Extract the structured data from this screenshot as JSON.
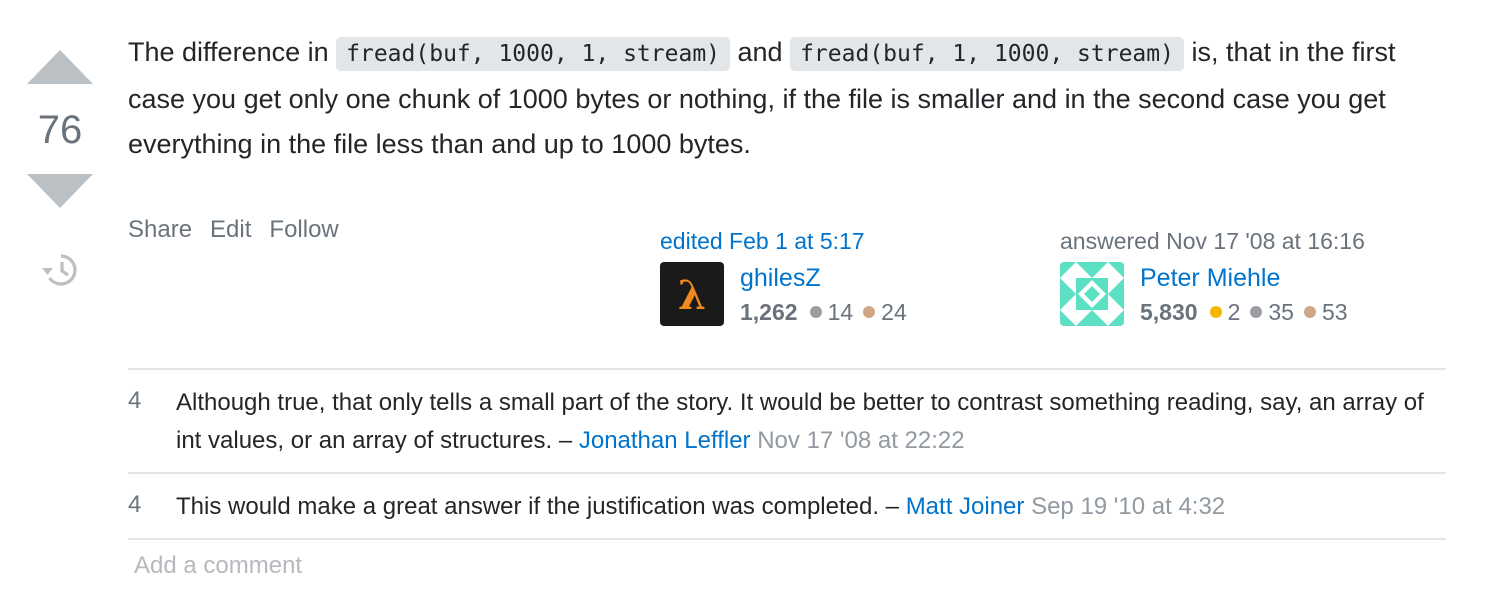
{
  "vote": {
    "count": "76",
    "up_icon": "triangle-up-icon",
    "down_icon": "triangle-down-icon",
    "history_icon": "history-icon"
  },
  "answer": {
    "part1": "The difference in ",
    "code1": "fread(buf, 1000, 1, stream)",
    "part2": " and ",
    "code2": "fread(buf, 1, 1000, stream)",
    "part3": " is, that in the first case you get only one chunk of 1000 bytes or nothing, if the file is smaller and in the second case you get everything in the file less than and up to 1000 bytes."
  },
  "menu": {
    "share": "Share",
    "edit": "Edit",
    "follow": "Follow"
  },
  "editor": {
    "action": "edited Feb 1 at 5:17",
    "name": "ghilesZ",
    "reputation": "1,262",
    "silver": "14",
    "bronze": "24"
  },
  "author": {
    "action": "answered Nov 17 '08 at 16:16",
    "name": "Peter Miehle",
    "reputation": "5,830",
    "gold": "2",
    "silver": "35",
    "bronze": "53"
  },
  "colors": {
    "gold": "#f1b600",
    "silver": "#9a9ea3",
    "bronze": "#d1a684",
    "link": "#0074cc"
  },
  "comments": [
    {
      "score": "4",
      "text": "Although true, that only tells a small part of the story. It would be better to contrast something reading, say, an array of int values, or an array of structures. – ",
      "user": "Jonathan Leffler",
      "date": " Nov 17 '08 at 22:22"
    },
    {
      "score": "4",
      "text": "This would make a great answer if the justification was completed. – ",
      "user": "Matt Joiner",
      "date": " Sep 19 '10 at 4:32"
    }
  ],
  "add_comment": "Add a comment"
}
